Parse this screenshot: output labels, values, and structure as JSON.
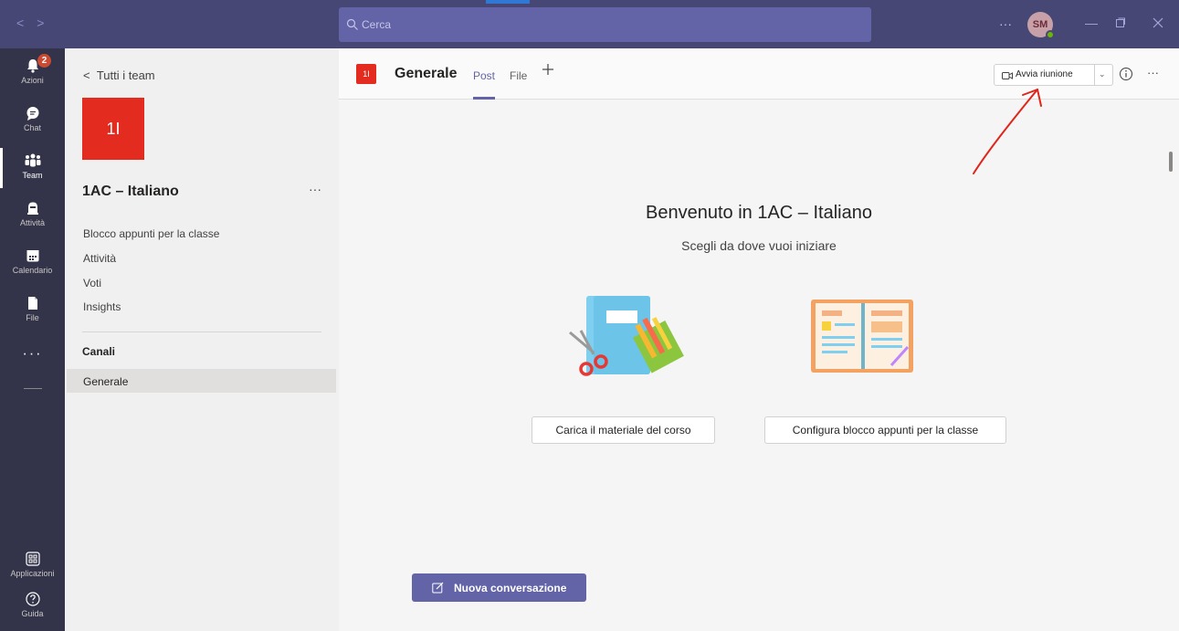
{
  "titlebar": {
    "search_placeholder": "Cerca",
    "more": "···",
    "avatar_initials": "SM",
    "colors": {
      "bar": "#464775",
      "search": "#6264a7"
    }
  },
  "rail": {
    "items": [
      {
        "label": "Azioni",
        "icon": "bell-icon",
        "badge": "2"
      },
      {
        "label": "Chat",
        "icon": "chat-icon"
      },
      {
        "label": "Team",
        "icon": "teams-icon",
        "active": true
      },
      {
        "label": "Attività",
        "icon": "assignments-icon"
      },
      {
        "label": "Calendario",
        "icon": "calendar-icon"
      },
      {
        "label": "File",
        "icon": "file-icon"
      }
    ],
    "more": "···",
    "bottom": [
      {
        "label": "Applicazioni",
        "icon": "apps-icon"
      },
      {
        "label": "Guida",
        "icon": "help-icon"
      }
    ]
  },
  "team_panel": {
    "back": "Tutti i team",
    "tile_text": "1I",
    "team_name": "1AC – Italiano",
    "more": "···",
    "links": [
      "Blocco appunti per la classe",
      "Attività",
      "Voti",
      "Insights"
    ],
    "channels_heading": "Canali",
    "channels": [
      "Generale"
    ]
  },
  "channel_header": {
    "tile_text": "1I",
    "title": "Generale",
    "tabs": [
      "Post",
      "File"
    ],
    "active_tab": "Post",
    "meet_button": "Avvia riunione",
    "more": "···"
  },
  "main": {
    "welcome_title": "Benvenuto in 1AC – Italiano",
    "welcome_subtitle": "Scegli da dove vuoi iniziare",
    "actions": [
      "Carica il materiale del corso",
      "Configura blocco appunti per la classe"
    ],
    "new_conversation": "Nuova conversazione"
  },
  "colors": {
    "accent": "#6264a7",
    "team_tile": "#e32b1f",
    "annotation": "#e0251b"
  }
}
